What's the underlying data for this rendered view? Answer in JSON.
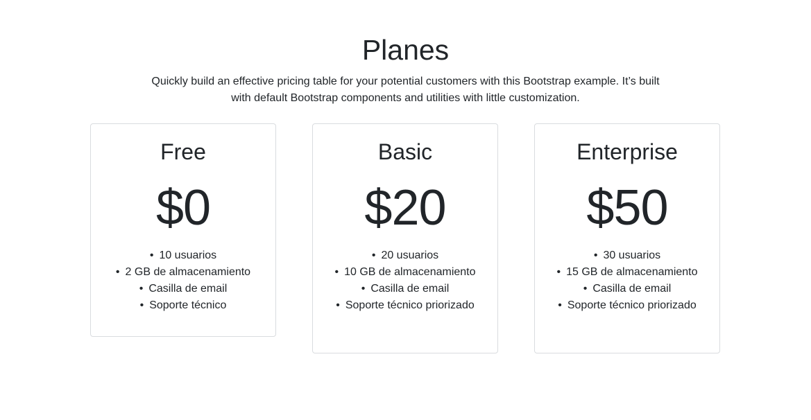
{
  "header": {
    "title": "Planes",
    "lead": "Quickly build an effective pricing table for your potential customers with this Bootstrap example. It’s built with default Bootstrap components and utilities with little customization."
  },
  "plans": [
    {
      "name": "Free",
      "price": "$0",
      "features": [
        "10 usuarios",
        "2 GB de almacenamiento",
        "Casilla de email",
        "Soporte técnico"
      ]
    },
    {
      "name": "Basic",
      "price": "$20",
      "features": [
        "20 usuarios",
        "10 GB de almacenamiento",
        "Casilla de email",
        "Soporte técnico priorizado"
      ]
    },
    {
      "name": "Enterprise",
      "price": "$50",
      "features": [
        "30 usuarios",
        "15 GB de almacenamiento",
        "Casilla de email",
        "Soporte técnico priorizado"
      ]
    }
  ]
}
